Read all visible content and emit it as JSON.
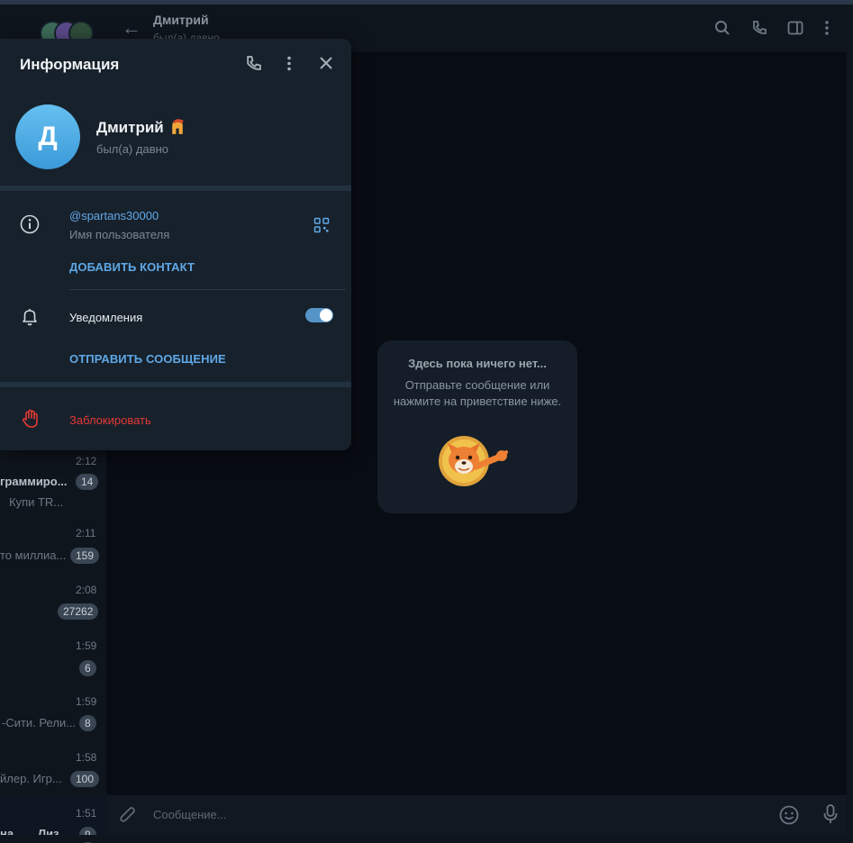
{
  "header": {
    "contact_name": "Дмитрий",
    "status": "был(а) давно"
  },
  "chat_list": [
    {
      "time": "2:12",
      "name": "граммиро...",
      "preview": "Купи TR...",
      "badge": "14"
    },
    {
      "time": "2:11",
      "preview": "то миллиа...",
      "badge": "159"
    },
    {
      "time": "2:08",
      "badge": "27262"
    },
    {
      "time": "1:59",
      "badge": "6"
    },
    {
      "time": "1:59",
      "preview": "-Сити. Рели...",
      "badge": "8"
    },
    {
      "time": "1:58",
      "preview": "йлер. Игр...",
      "badge": "100"
    },
    {
      "time": "1:51",
      "name": "на",
      "name2": "Лиз...",
      "badge": "9"
    }
  ],
  "empty_chat": {
    "title": "Здесь пока ничего нет...",
    "subtitle": "Отправьте сообщение или нажмите на приветствие ниже.",
    "sticker": "fox-greeting-sticker"
  },
  "composer": {
    "placeholder": "Сообщение..."
  },
  "info_panel": {
    "title": "Информация",
    "avatar_letter": "Д",
    "name": "Дмитрий",
    "status": "был(а) давно",
    "username": "@spartans30000",
    "username_label": "Имя пользователя",
    "add_contact": "ДОБАВИТЬ КОНТАКТ",
    "notifications_label": "Уведомления",
    "notifications_enabled": true,
    "send_message": "ОТПРАВИТЬ СООБЩЕНИЕ",
    "block": "Заблокировать"
  },
  "colors": {
    "accent": "#5fa8e7",
    "danger": "#e53935",
    "panel": "#17212b",
    "background": "#0e1621"
  },
  "icons": [
    "back-arrow-icon",
    "search-icon",
    "phone-icon",
    "sidebar-toggle-icon",
    "more-vertical-icon",
    "close-icon",
    "info-icon",
    "qr-code-icon",
    "bell-icon",
    "hand-stop-icon",
    "attach-icon",
    "emoji-icon",
    "microphone-icon"
  ]
}
